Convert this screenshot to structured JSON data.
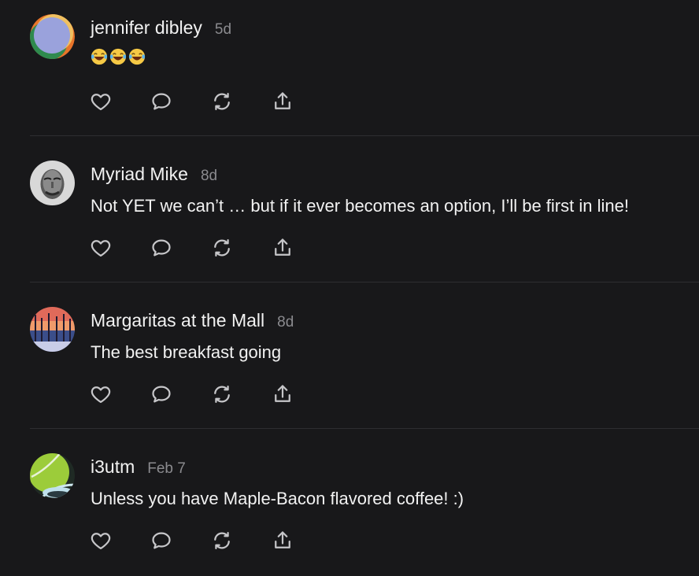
{
  "comments": [
    {
      "author": "jennifer dibley",
      "time": "5d",
      "text": "😂😂😂",
      "avatar_icon": "abstract-gradient-avatar",
      "actions": [
        "like",
        "reply",
        "restack",
        "share"
      ]
    },
    {
      "author": "Myriad Mike",
      "time": "8d",
      "text": "Not YET we can’t … but if it ever becomes an option, I’ll be first in line!",
      "avatar_icon": "portrait-photo-avatar",
      "actions": [
        "like",
        "reply",
        "restack",
        "share"
      ]
    },
    {
      "author": "Margaritas at the Mall",
      "time": "8d",
      "text": "The best breakfast going",
      "avatar_icon": "sunset-trees-avatar",
      "actions": [
        "like",
        "reply",
        "restack",
        "share"
      ]
    },
    {
      "author": "i3utm",
      "time": "Feb 7",
      "text": "Unless you have Maple-Bacon flavored coffee! :)",
      "avatar_icon": "tennis-ball-avatar",
      "actions": [
        "like",
        "reply",
        "restack",
        "share"
      ]
    }
  ],
  "colors": {
    "background": "#18181a",
    "text": "#f2f2f2",
    "muted": "#8b8b8f",
    "icon": "#c6c6c9",
    "divider": "#2e2e31"
  }
}
